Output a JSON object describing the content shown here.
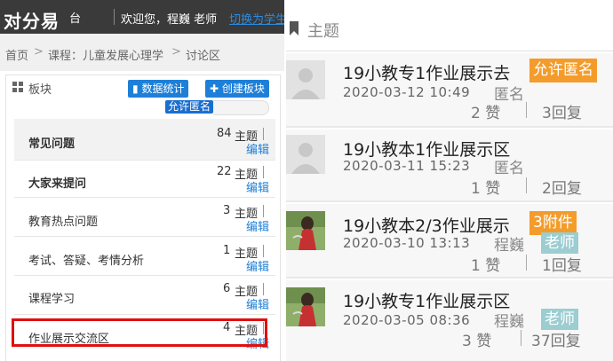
{
  "header": {
    "logo": "对分易",
    "logo_suffix": "台",
    "welcome": "欢迎您，程巍 老师",
    "switch_link": "切换为学生"
  },
  "breadcrumb": [
    "首页",
    "课程：儿童发展心理学",
    "讨论区"
  ],
  "boards_panel": {
    "title": "板块",
    "stats_button": "数据统计",
    "create_button": "创建板块",
    "allow_anonymous": "允许匿名",
    "count_suffix": "主题",
    "edit_label": "编辑",
    "items": [
      {
        "name": "常见问题",
        "count": "84"
      },
      {
        "name": "大家来提问",
        "count": "22"
      },
      {
        "name": "教育热点问题",
        "count": "3"
      },
      {
        "name": "考试、答疑、考情分析",
        "count": "1"
      },
      {
        "name": "课程学习",
        "count": "6"
      },
      {
        "name": "作业展示交流区",
        "count": "4"
      }
    ]
  },
  "topics": {
    "heading": "主题",
    "posts": [
      {
        "title": "19小教专1作业展示去",
        "badge": "允许匿名",
        "date": "2020-03-12 10:49",
        "author": "匿名",
        "likes": "2 赞",
        "replies": "3回复"
      },
      {
        "title": "19小教本1作业展示区",
        "date": "2020-03-11 15:23",
        "author": "匿名",
        "likes": "1 赞",
        "replies": "2回复"
      },
      {
        "title": "19小教本2/3作业展示",
        "badge": "3附件",
        "date": "2020-03-10 13:13",
        "author": "程巍",
        "role": "老师",
        "likes": "1 赞",
        "replies": "1回复"
      },
      {
        "title": "19小教专1作业展示区",
        "date": "2020-03-05 08:36",
        "author": "程巍",
        "role": "老师",
        "likes": "3 赞",
        "replies": "37回复"
      }
    ]
  },
  "colors": {
    "accent_blue": "#1e7fd8",
    "highlight_red": "#e01010",
    "badge_orange": "#f39c2b",
    "teacher_tag": "#9bcdd1"
  }
}
